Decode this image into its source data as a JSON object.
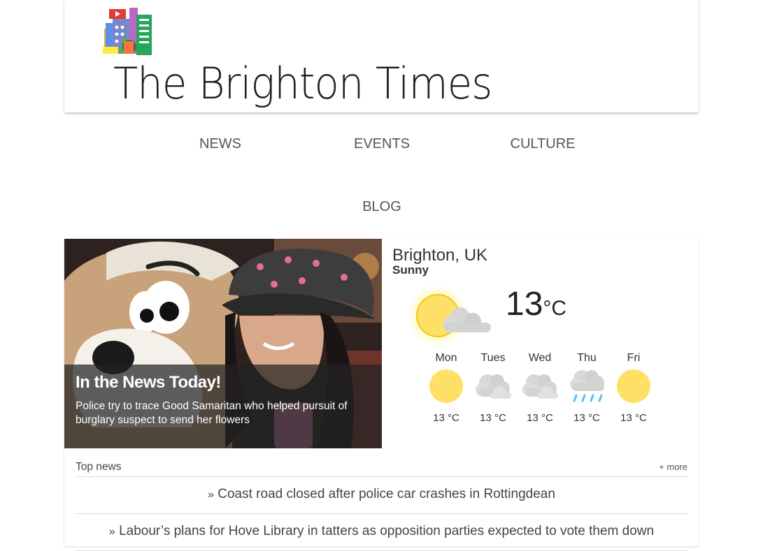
{
  "site": {
    "title": "The Brighton Times"
  },
  "nav": [
    {
      "label": "NEWS"
    },
    {
      "label": "EVENTS"
    },
    {
      "label": "CULTURE"
    },
    {
      "label": "BLOG"
    }
  ],
  "feature": {
    "title": "In the News Today!",
    "text": "Police try to trace Good Samaritan who helped pursuit of burglary suspect to send her flowers"
  },
  "weather": {
    "location": "Brighton, UK",
    "condition": "Sunny",
    "temp": "13",
    "unit": "°C",
    "icon": "sun-cloud-icon",
    "forecast": [
      {
        "day": "Mon",
        "temp": "13 °C",
        "icon": "sun-icon"
      },
      {
        "day": "Tues",
        "temp": "13 °C",
        "icon": "cloud-icon"
      },
      {
        "day": "Wed",
        "temp": "13 °C",
        "icon": "cloud-icon"
      },
      {
        "day": "Thu",
        "temp": "13 °C",
        "icon": "rain-icon"
      },
      {
        "day": "Fri",
        "temp": "13 °C",
        "icon": "sun-icon"
      }
    ]
  },
  "top_news": {
    "label": "Top news",
    "more": "+ more",
    "bullet": "»",
    "stories": [
      "Coast road closed after police car crashes in Rottingdean",
      "Labour’s plans for Hove Library in tatters as opposition parties expected to vote them down"
    ]
  },
  "colors": {
    "sun": "#ffe066",
    "cloud": "#d6d6d6",
    "rain": "#4fc3f7"
  }
}
